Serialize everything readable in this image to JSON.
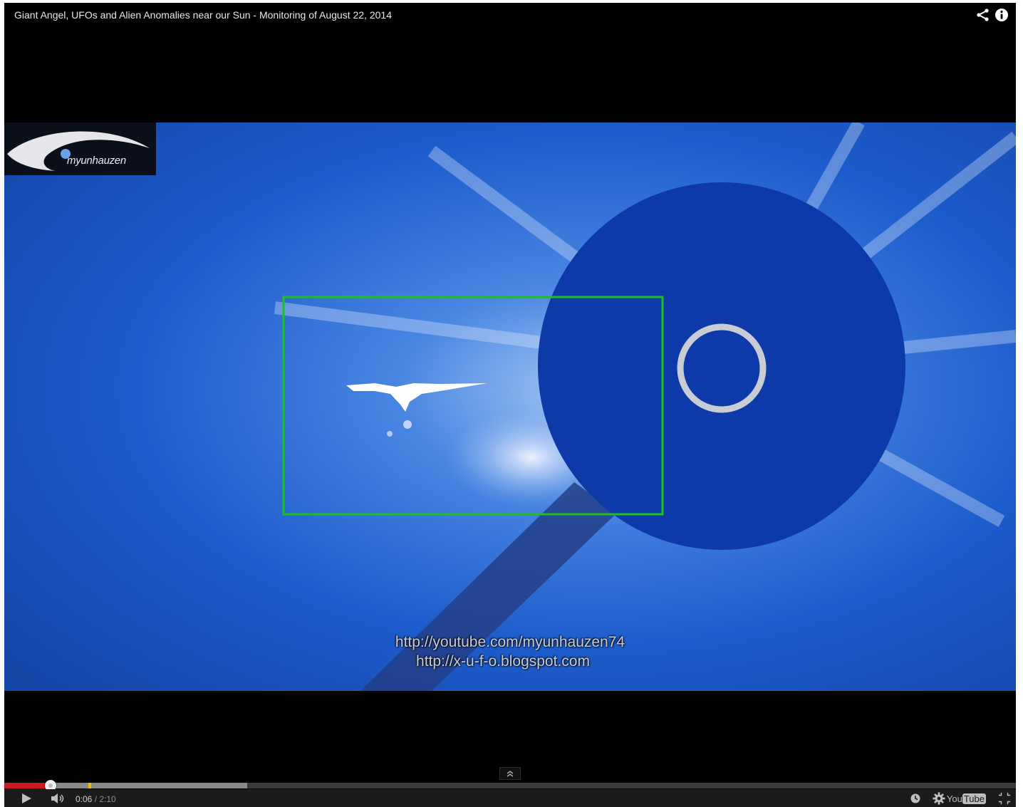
{
  "video": {
    "title": "Giant Angel, UFOs and Alien Anomalies near our Sun - Monitoring of August 22, 2014"
  },
  "top_icons": [
    "share-icon",
    "info-icon"
  ],
  "overlay": {
    "logo_text": "myunhauzen",
    "url_1": "http://youtube.com/myunhauzen74",
    "url_2": "http://x-u-f-o.blogspot.com",
    "highlight_color": "#1ec01e"
  },
  "playback": {
    "current_time": "0:06",
    "separator": " / ",
    "duration": "2:10",
    "played_fraction": 0.046,
    "buffered_fraction": 0.24,
    "state": "paused"
  },
  "controls": {
    "left": [
      "play-icon",
      "volume-icon"
    ],
    "right": [
      "watch-later-icon",
      "settings-gear-icon",
      "youtube-logo",
      "fullscreen-icon"
    ],
    "logo_you": "You",
    "logo_tube": "Tube"
  },
  "colors": {
    "progress_played": "#cc181e",
    "ad_marker": "#e8c000",
    "sky_blue": "#1b5fd0"
  }
}
